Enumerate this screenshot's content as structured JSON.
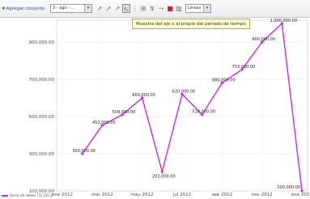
{
  "toolbar": {
    "add_series": "Agregar conjunto",
    "range_select": "3 - ago - ...",
    "range_arrow": "▾",
    "zoom_select": "Líneas",
    "zoom_arrow": "▾",
    "tools": [
      {
        "icon": "zoom-in-icon",
        "glyph": "↗"
      },
      {
        "icon": "zoom-out-icon",
        "glyph": "↗"
      },
      {
        "icon": "zoom-box-icon",
        "glyph": "↗"
      },
      {
        "icon": "pointer-icon",
        "glyph": "↖",
        "active": true
      },
      {
        "icon": "separator",
        "glyph": "⋮"
      },
      {
        "icon": "grid-icon",
        "glyph": "⊞"
      },
      {
        "icon": "axis-icon",
        "glyph": "↯"
      },
      {
        "icon": "marker-icon",
        "glyph": "⤳"
      },
      {
        "icon": "palette-icon",
        "glyph": "■"
      },
      {
        "icon": "bar-chart-icon",
        "glyph": "▥"
      }
    ]
  },
  "tooltip": {
    "text": "Muestra del eje x al propio del periodo de tiempo"
  },
  "chart_data": {
    "type": "line",
    "x": [
      "ene 2012",
      "feb 2012",
      "mar 2012",
      "abr 2012",
      "may 2012",
      "jun 2012",
      "jul 2012",
      "ago 2012",
      "sep 2012",
      "oct 2012",
      "nov 2012",
      "dic 2012",
      "ene 2013"
    ],
    "values": [
      300000,
      453000,
      509000,
      600000,
      203000,
      620000,
      510000,
      680000,
      753000,
      900000,
      1000000,
      100000
    ],
    "data_labels": [
      "300,000.00",
      "453,000.00",
      "509,000.00",
      "600,000.00",
      "203,000.00",
      "620,000.00",
      "510,000.00",
      "680,000.00",
      "753,000.00",
      "900,000.00",
      "1,000,000.00",
      "100,000.00"
    ],
    "x_tick_labels": [
      "ene 2012",
      "mar 2012",
      "may 2012",
      "jul 2012",
      "sep 2012",
      "nov 2012",
      "ene 2013"
    ],
    "y_tick_labels": [
      "100,000.00",
      "300,000.00",
      "500,000.00",
      "700,000.00",
      "900,000.00"
    ],
    "y_tick_values": [
      100000,
      300000,
      500000,
      700000,
      900000
    ],
    "ylim": [
      100000,
      1000000
    ],
    "grid": true,
    "series_color": "#d02bd0",
    "legend_position": "bottom-left"
  },
  "legend": {
    "text": "Serie de datos [1] 2012"
  }
}
